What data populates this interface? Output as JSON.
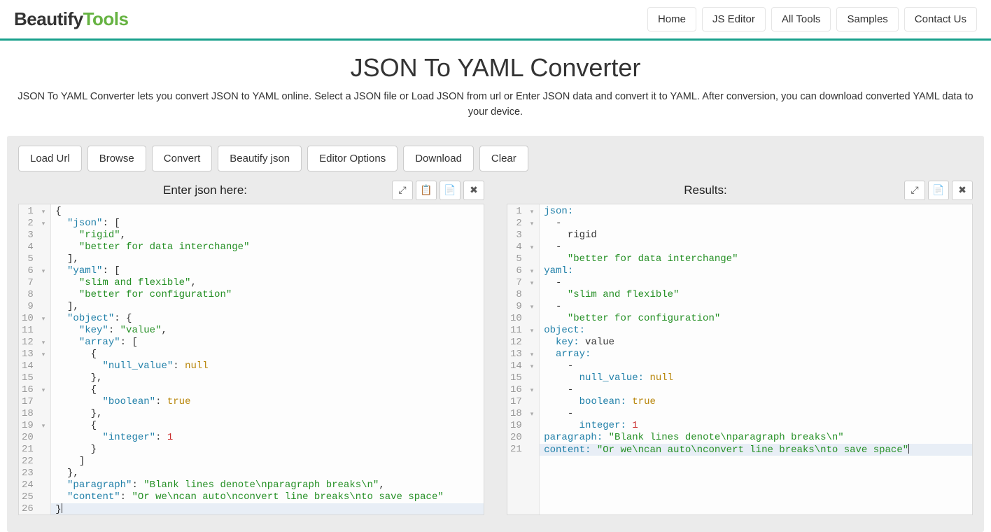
{
  "brand": {
    "part1": "Beautify",
    "part2": "Tools"
  },
  "nav": {
    "home": "Home",
    "jseditor": "JS Editor",
    "alltools": "All Tools",
    "samples": "Samples",
    "contact": "Contact Us"
  },
  "hero": {
    "title": "JSON To YAML Converter",
    "desc": "JSON To YAML Converter lets you convert JSON to YAML online. Select a JSON file or Load JSON from url or Enter JSON data and convert it to YAML. After conversion, you can download converted YAML data to your device."
  },
  "toolbar": {
    "load_url": "Load Url",
    "browse": "Browse",
    "convert": "Convert",
    "beautify": "Beautify json",
    "options": "Editor Options",
    "download": "Download",
    "clear": "Clear"
  },
  "panels": {
    "left_title": "Enter json here:",
    "right_title": "Results:"
  },
  "ctrl_icons": {
    "fullscreen": "⤢",
    "paste": "📋",
    "copy": "📄",
    "close": "✖"
  },
  "json_lines": [
    {
      "n": 1,
      "fold": true,
      "html": "<span class='tk-punc'>{</span>"
    },
    {
      "n": 2,
      "fold": true,
      "html": "  <span class='tk-key'>\"json\"</span><span class='tk-punc'>: [</span>"
    },
    {
      "n": 3,
      "fold": false,
      "html": "    <span class='tk-str'>\"rigid\"</span><span class='tk-punc'>,</span>"
    },
    {
      "n": 4,
      "fold": false,
      "html": "    <span class='tk-str'>\"better for data interchange\"</span>"
    },
    {
      "n": 5,
      "fold": false,
      "html": "  <span class='tk-punc'>],</span>"
    },
    {
      "n": 6,
      "fold": true,
      "html": "  <span class='tk-key'>\"yaml\"</span><span class='tk-punc'>: [</span>"
    },
    {
      "n": 7,
      "fold": false,
      "html": "    <span class='tk-str'>\"slim and flexible\"</span><span class='tk-punc'>,</span>"
    },
    {
      "n": 8,
      "fold": false,
      "html": "    <span class='tk-str'>\"better for configuration\"</span>"
    },
    {
      "n": 9,
      "fold": false,
      "html": "  <span class='tk-punc'>],</span>"
    },
    {
      "n": 10,
      "fold": true,
      "html": "  <span class='tk-key'>\"object\"</span><span class='tk-punc'>: {</span>"
    },
    {
      "n": 11,
      "fold": false,
      "html": "    <span class='tk-key'>\"key\"</span><span class='tk-punc'>: </span><span class='tk-str'>\"value\"</span><span class='tk-punc'>,</span>"
    },
    {
      "n": 12,
      "fold": true,
      "html": "    <span class='tk-key'>\"array\"</span><span class='tk-punc'>: [</span>"
    },
    {
      "n": 13,
      "fold": true,
      "html": "      <span class='tk-punc'>{</span>"
    },
    {
      "n": 14,
      "fold": false,
      "html": "        <span class='tk-key'>\"null_value\"</span><span class='tk-punc'>: </span><span class='tk-null'>null</span>"
    },
    {
      "n": 15,
      "fold": false,
      "html": "      <span class='tk-punc'>},</span>"
    },
    {
      "n": 16,
      "fold": true,
      "html": "      <span class='tk-punc'>{</span>"
    },
    {
      "n": 17,
      "fold": false,
      "html": "        <span class='tk-key'>\"boolean\"</span><span class='tk-punc'>: </span><span class='tk-bool'>true</span>"
    },
    {
      "n": 18,
      "fold": false,
      "html": "      <span class='tk-punc'>},</span>"
    },
    {
      "n": 19,
      "fold": true,
      "html": "      <span class='tk-punc'>{</span>"
    },
    {
      "n": 20,
      "fold": false,
      "html": "        <span class='tk-key'>\"integer\"</span><span class='tk-punc'>: </span><span class='tk-num'>1</span>"
    },
    {
      "n": 21,
      "fold": false,
      "html": "      <span class='tk-punc'>}</span>"
    },
    {
      "n": 22,
      "fold": false,
      "html": "    <span class='tk-punc'>]</span>"
    },
    {
      "n": 23,
      "fold": false,
      "html": "  <span class='tk-punc'>},</span>"
    },
    {
      "n": 24,
      "fold": false,
      "html": "  <span class='tk-key'>\"paragraph\"</span><span class='tk-punc'>: </span><span class='tk-str'>\"Blank lines denote\\nparagraph breaks\\n\"</span><span class='tk-punc'>,</span>"
    },
    {
      "n": 25,
      "fold": false,
      "html": "  <span class='tk-key'>\"content\"</span><span class='tk-punc'>: </span><span class='tk-str'>\"Or we\\ncan auto\\nconvert line breaks\\nto save space\"</span>"
    },
    {
      "n": 26,
      "fold": false,
      "hl": true,
      "html": "<span class='tk-punc'>}</span><span class='cursor-mark'></span>"
    }
  ],
  "yaml_lines": [
    {
      "n": 1,
      "fold": true,
      "html": "<span class='tk-yaml-key'>json:</span>"
    },
    {
      "n": 2,
      "fold": true,
      "html": "  <span class='tk-punc'>-</span>"
    },
    {
      "n": 3,
      "fold": false,
      "html": "    <span class='tk-yaml-scalar'>rigid</span>"
    },
    {
      "n": 4,
      "fold": true,
      "html": "  <span class='tk-punc'>-</span>"
    },
    {
      "n": 5,
      "fold": false,
      "html": "    <span class='tk-yaml-str'>\"better for data interchange\"</span>"
    },
    {
      "n": 6,
      "fold": true,
      "html": "<span class='tk-yaml-key'>yaml:</span>"
    },
    {
      "n": 7,
      "fold": true,
      "html": "  <span class='tk-punc'>-</span>"
    },
    {
      "n": 8,
      "fold": false,
      "html": "    <span class='tk-yaml-str'>\"slim and flexible\"</span>"
    },
    {
      "n": 9,
      "fold": true,
      "html": "  <span class='tk-punc'>-</span>"
    },
    {
      "n": 10,
      "fold": false,
      "html": "    <span class='tk-yaml-str'>\"better for configuration\"</span>"
    },
    {
      "n": 11,
      "fold": true,
      "html": "<span class='tk-yaml-key'>object:</span>"
    },
    {
      "n": 12,
      "fold": false,
      "html": "  <span class='tk-yaml-key'>key:</span> <span class='tk-yaml-scalar'>value</span>"
    },
    {
      "n": 13,
      "fold": true,
      "html": "  <span class='tk-yaml-key'>array:</span>"
    },
    {
      "n": 14,
      "fold": true,
      "html": "    <span class='tk-punc'>-</span>"
    },
    {
      "n": 15,
      "fold": false,
      "html": "      <span class='tk-yaml-key'>null_value:</span> <span class='tk-null'>null</span>"
    },
    {
      "n": 16,
      "fold": true,
      "html": "    <span class='tk-punc'>-</span>"
    },
    {
      "n": 17,
      "fold": false,
      "html": "      <span class='tk-yaml-key'>boolean:</span> <span class='tk-bool'>true</span>"
    },
    {
      "n": 18,
      "fold": true,
      "html": "    <span class='tk-punc'>-</span>"
    },
    {
      "n": 19,
      "fold": false,
      "html": "      <span class='tk-yaml-key'>integer:</span> <span class='tk-num'>1</span>"
    },
    {
      "n": 20,
      "fold": false,
      "html": "<span class='tk-yaml-key'>paragraph:</span> <span class='tk-yaml-str'>\"Blank lines denote\\nparagraph breaks\\n\"</span>"
    },
    {
      "n": 21,
      "fold": false,
      "hl": true,
      "html": "<span class='tk-yaml-key'>content:</span> <span class='tk-yaml-str'>\"Or we\\ncan auto\\nconvert line breaks\\nto save space\"</span><span class='cursor-mark'></span>"
    }
  ]
}
